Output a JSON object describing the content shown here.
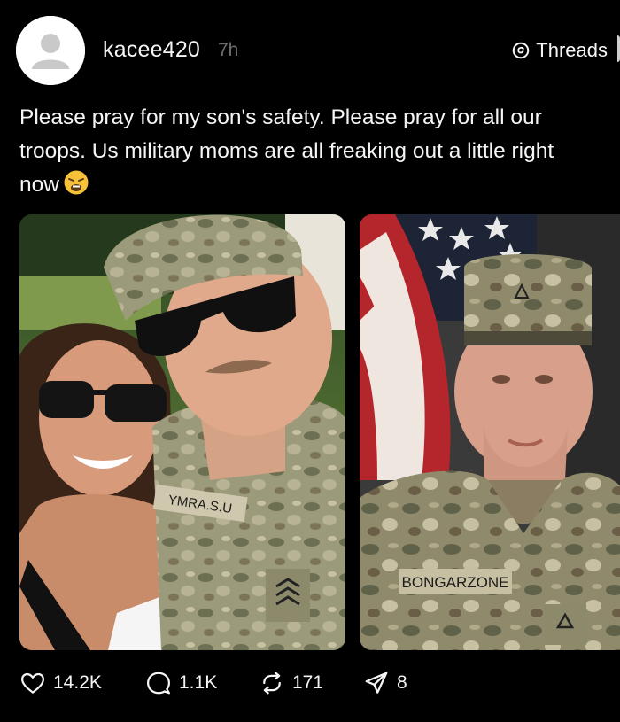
{
  "post": {
    "username": "kacee420",
    "time_ago": "7h",
    "app_name": "Threads",
    "text": "Please pray for my son's safety. Please pray for all our troops. Us military moms are all freaking out a little right now",
    "emoji": "weary-face-emoji"
  },
  "photos": [
    {
      "name_tape": "YMRA.S.U"
    },
    {
      "name_tape": "BONGARZONE"
    }
  ],
  "actions": {
    "likes": "14.2K",
    "comments": "1.1K",
    "reposts": "171",
    "shares": "8"
  },
  "icons": [
    "user-avatar-icon",
    "threads-logo-icon",
    "heart-icon",
    "comment-icon",
    "repost-icon",
    "send-icon"
  ],
  "colors": {
    "background": "#000000",
    "text": "#f3f5f7",
    "muted": "#6f6f6f"
  }
}
